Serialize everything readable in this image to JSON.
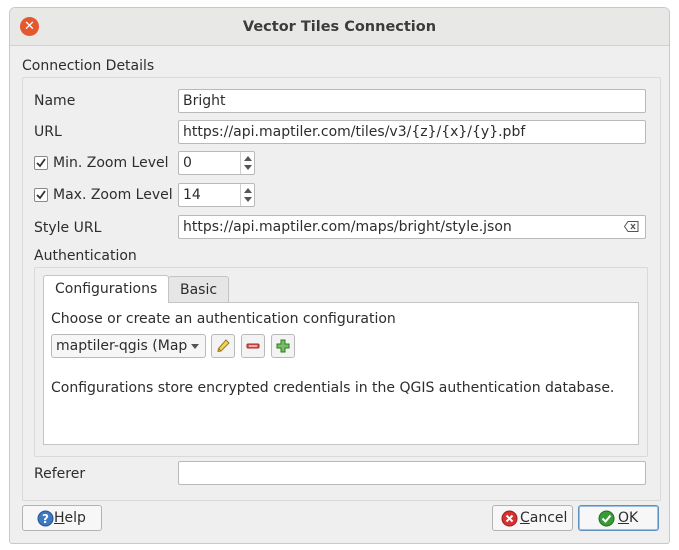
{
  "window": {
    "title": "Vector Tiles Connection"
  },
  "connection": {
    "group_title": "Connection Details",
    "name_label": "Name",
    "name_value": "Bright",
    "url_label": "URL",
    "url_value": "https://api.maptiler.com/tiles/v3/{z}/{x}/{y}.pbf",
    "min_zoom_label": "Min. Zoom Level",
    "min_zoom_checked": true,
    "min_zoom_value": "0",
    "max_zoom_label": "Max. Zoom Level",
    "max_zoom_checked": true,
    "max_zoom_value": "14",
    "style_url_label": "Style URL",
    "style_url_value": "https://api.maptiler.com/maps/bright/style.json",
    "referer_label": "Referer",
    "referer_value": ""
  },
  "auth": {
    "label": "Authentication",
    "tabs": [
      {
        "label": "Configurations",
        "active": true
      },
      {
        "label": "Basic",
        "active": false
      }
    ],
    "choose_label": "Choose or create an authentication configuration",
    "selected_config": "maptiler-qgis (Map",
    "info_text": "Configurations store encrypted credentials in the QGIS authentication database."
  },
  "buttons": {
    "help": "Help",
    "help_mnemonic": "H",
    "help_rest": "elp",
    "cancel_mnemonic": "C",
    "cancel_rest": "ancel",
    "ok_mnemonic": "O",
    "ok_rest": "K"
  },
  "icons": {
    "close": "close-icon",
    "help": "help-icon",
    "cancel": "cancel-icon",
    "ok": "ok-icon",
    "edit": "pencil-icon",
    "remove": "remove-icon",
    "add": "add-icon",
    "clear": "clear-text-icon"
  },
  "colors": {
    "close_button": "#e5582e",
    "cancel_icon": "#d93030",
    "ok_icon": "#3a9a3a",
    "help_icon": "#3d78c2"
  }
}
